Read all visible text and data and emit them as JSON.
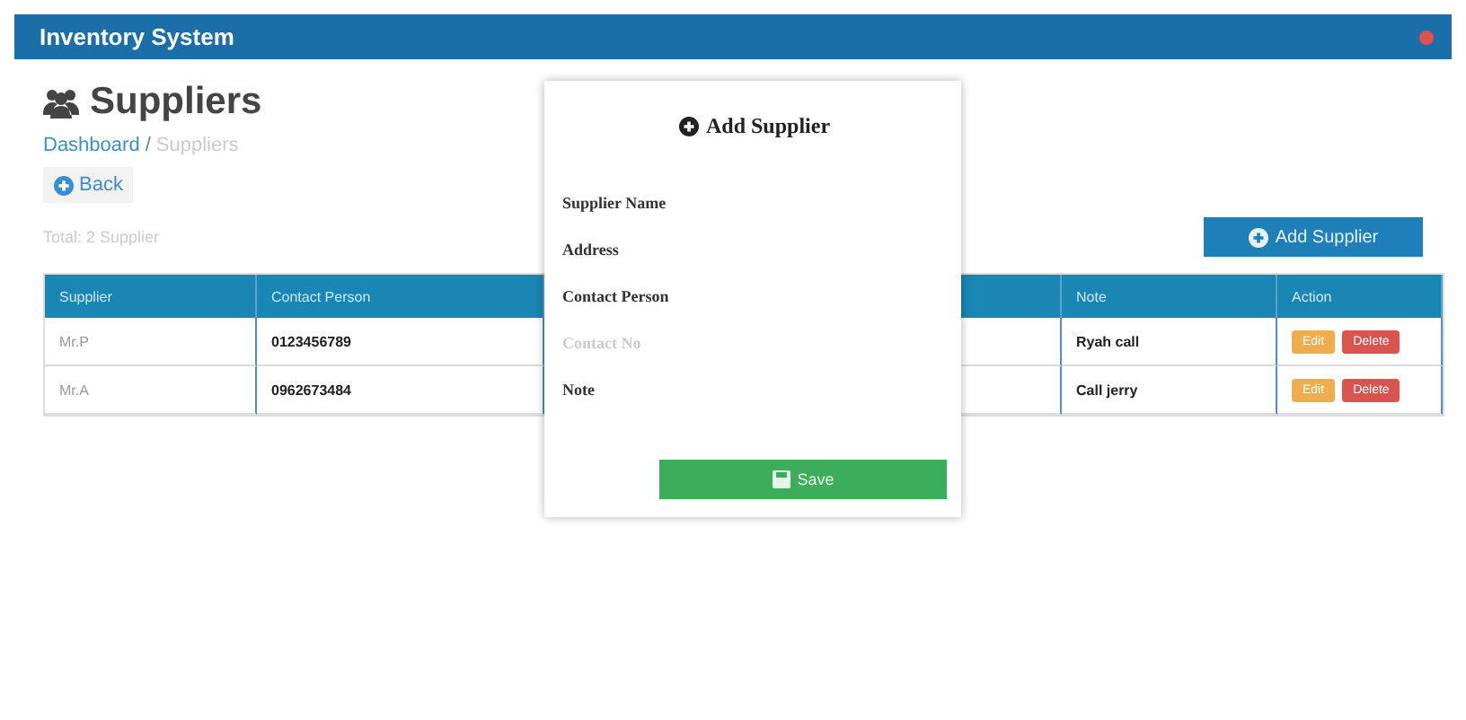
{
  "window": {
    "title": "Inventory System"
  },
  "page": {
    "title": "Suppliers",
    "breadcrumb_separator": "/",
    "breadcrumb": [
      {
        "label": "Dashboard",
        "kind": "link"
      },
      {
        "label": "Suppliers",
        "kind": "current"
      }
    ],
    "back": "Back",
    "summary": "Total: 2 Supplier",
    "add_button": "Add Supplier"
  },
  "table": {
    "columns": [
      "Supplier",
      "Contact Person",
      "",
      "Note",
      "Action"
    ],
    "rows": [
      {
        "supplier": "Mr.P",
        "contact": "0123456789",
        "note": "Ryah call",
        "edit": "Edit",
        "delete": "Delete"
      },
      {
        "supplier": "Mr.A",
        "contact": "0962673484",
        "note": "Call jerry",
        "edit": "Edit",
        "delete": "Delete"
      }
    ]
  },
  "modal": {
    "title": "Add Supplier",
    "fields": [
      {
        "label": "Supplier Name",
        "disabled": false
      },
      {
        "label": "Address",
        "disabled": false
      },
      {
        "label": "Contact Person",
        "disabled": false
      },
      {
        "label": "Contact No",
        "disabled": true
      },
      {
        "label": "Note",
        "disabled": false
      }
    ],
    "save": "Save"
  }
}
